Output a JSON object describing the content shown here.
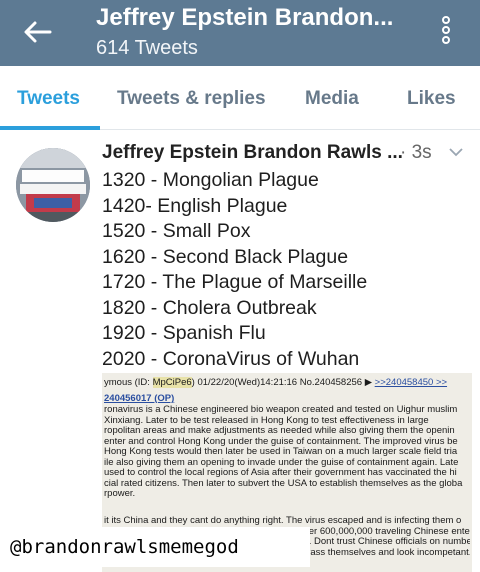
{
  "header": {
    "title": "Jeffrey Epstein Brandon...",
    "tweet_count": "614 Tweets"
  },
  "tabs": [
    {
      "label": "Tweets",
      "active": true
    },
    {
      "label": "Tweets & replies",
      "active": false
    },
    {
      "label": "Media",
      "active": false
    },
    {
      "label": "Likes",
      "active": false
    }
  ],
  "tweet": {
    "author": "Jeffrey Epstein Brandon Rawls ...",
    "time": "· 3s",
    "lines": [
      "1320 - Mongolian Plague",
      "1420- English Plague",
      "1520 - Small Pox",
      "1620 - Second Black Plague",
      "1720 - The Plague of Marseille",
      "1820 - Cholera Outbreak",
      "1920 - Spanish Flu",
      "2020 - CoronaVirus of Wuhan"
    ],
    "embedded_post": {
      "header_prefix": "ymous (ID: ",
      "id": "MpCiPe6",
      "header_suffix": ") 01/22/20(Wed)14:21:16 No.240458256 ▶ ",
      "reply_link": ">>240458450 >>",
      "ref": "240456017 (OP)",
      "body": [
        "ronavirus is a Chinese engineered bio weapon created and tested on Uighur muslim",
        "Xinxiang. Later to be test released in Hong Kong to test effectiveness in large",
        "ropolitan areas and make adjustments as needed while also giving them the openin",
        "enter and control Hong Kong under the guise of containment. The improved virus be",
        "Hong Kong tests would then later be used in Taiwan on a much larger scale field tria",
        "ile also giving them an opening to invade under the guise of containment again. Late",
        "used to control the local regions of Asia after their government has vaccinated the hi",
        "cial rated citizens. Then later to subvert the USA to establish themselves as the globa",
        "rpower."
      ],
      "body2": [
        "it its China and they cant do anything right. The virus escaped and is infecting them o",
        "ver 600,000,000 traveling Chinese enteri",
        "s. Dont trust Chinese officials on number",
        "rrass themselves and look incompetant."
      ]
    }
  },
  "watermark": "@brandonrawlsmemegod",
  "colors": {
    "header_bg": "#5d7a93",
    "accent": "#2b9fdc",
    "tab_inactive": "#67798a"
  }
}
